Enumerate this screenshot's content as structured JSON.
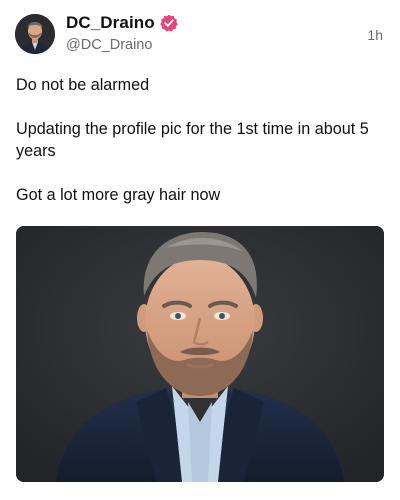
{
  "post": {
    "author": {
      "display_name": "DC_Draino",
      "handle": "@DC_Draino",
      "verified": true,
      "verified_color": "#e6457a"
    },
    "timestamp": "1h",
    "paragraphs": [
      "Do not be alarmed",
      "Updating the profile pic for the 1st time in about 5 years",
      "Got a lot more gray hair now"
    ],
    "media": {
      "type": "photo"
    }
  },
  "icons": {
    "avatar": "profile-photo",
    "verified": "verified-badge-icon"
  }
}
